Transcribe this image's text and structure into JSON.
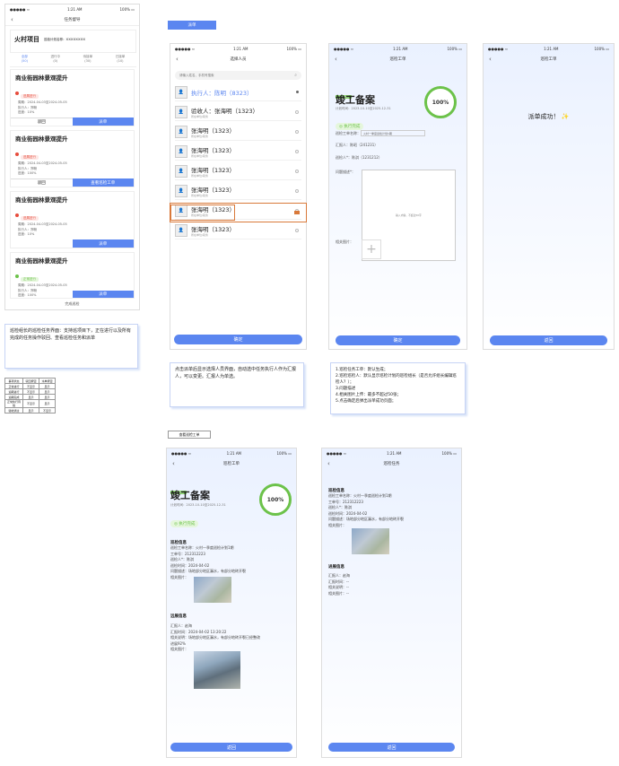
{
  "status_bar": {
    "left": "●●●●● ≈",
    "time": "1:21 AM",
    "battery": "100%"
  },
  "phone1": {
    "nav_title": "任务督导",
    "project_name": "火村项目",
    "project_sub": "巡检计划名称：XXXXXXXX",
    "tabs": [
      {
        "label": "全部",
        "count": "(50)"
      },
      {
        "label": "进行中",
        "count": "(0)"
      },
      {
        "label": "待接单",
        "count": "(30)"
      },
      {
        "label": "已接单",
        "count": "(10)"
      }
    ],
    "cards": [
      {
        "title": "商业街园林景观提升",
        "status": "进展进行",
        "status_color": "#e74c3c",
        "period": "周期：2024-04-03至2024-05-05",
        "executor": "执行人：郑畅",
        "progress": "进度：10%",
        "btn_left": "驳回",
        "btn_right": "派单"
      },
      {
        "title": "商业街园林景观提升",
        "status": "进展进行",
        "status_color": "#e74c3c",
        "period": "周期：2024-04-03至2024-05-05",
        "executor": "执行人：郑畅",
        "progress": "进度：100%",
        "btn_left": "驳回",
        "btn_right": "查看巡检工单"
      },
      {
        "title": "商业街园林景观提升",
        "status": "进展进行",
        "status_color": "#e74c3c",
        "period": "周期：2024-04-03至2024-05-05",
        "executor": "执行人：郑畅",
        "progress": "进度：10%",
        "btn_right": "派单"
      },
      {
        "title": "商业街园林景观提升",
        "status": "正常进行",
        "status_color": "#6cc24a",
        "period": "周期：2024-04-03至2024-05-05",
        "executor": "执行人：郑畅",
        "progress": "进度：100%",
        "btn_right": "派单"
      }
    ],
    "footer": "完成巡检"
  },
  "note1": "巡检组长的巡检任务界面：支持巡项目下，正在进行以及所有完成的任务操作驳回、查看巡检任务和派单",
  "status_table": {
    "headers": [
      "事项状态",
      "驳回按钮",
      "派单按钮"
    ],
    "rows": [
      [
        "正常进行",
        "不显示",
        "显示"
      ],
      [
        "逾期进行",
        "不显示",
        "显示"
      ],
      [
        "逾期完成",
        "显示",
        "显示"
      ],
      [
        "正常执行待验",
        "不显示",
        "显示"
      ],
      [
        "验收通过",
        "显示",
        "不显示"
      ]
    ]
  },
  "label_dispatch": "派单",
  "phone2": {
    "nav_title": "选择人员",
    "search_placeholder": "请输入姓名、手机号搜索",
    "people": [
      {
        "name": "执行人：陈明（8323）",
        "sub": "",
        "highlight": true
      },
      {
        "name": "验收人：张海明（1323）",
        "sub": "所在单位/职务"
      },
      {
        "name": "张海明（1323）",
        "sub": "所在单位/职务"
      },
      {
        "name": "张海明（1323）",
        "sub": "所在单位/职务"
      },
      {
        "name": "张海明（1323）",
        "sub": "所在单位/职务"
      },
      {
        "name": "张海明（1323）",
        "sub": "所在单位/职务",
        "selected": true
      },
      {
        "name": "张海明（1323）",
        "sub": "所在单位/职务"
      },
      {
        "name": "张海明（1323）",
        "sub": "所在单位/职务"
      }
    ],
    "confirm": "确定"
  },
  "note2": "点击派单后显示选择人员界面，自动选中任务执行人作为汇报人，可以变更。汇报人为单选。",
  "phone3": {
    "nav_title": "巡检工单",
    "tag": "工程项目",
    "title": "竣工备案",
    "plan": "计划时间：2023-10-10至2025-12-31",
    "status": "执行完成",
    "percent": "100%",
    "order_label": "巡检工单名称：",
    "order_value": "火村一季度巡检计划1期",
    "reporter": "汇报人：陈昭（241231）",
    "inspector": "巡检人*：陈淇（1231212）",
    "desc_label": "问题描述*：",
    "desc_placeholder": "输入内容，不超过50字",
    "photo_label": "相关图片：",
    "confirm": "确定"
  },
  "note3": [
    "1.巡检任务工单：默认生成；",
    "2.巡检巡检人：默认显示巡检计划的巡检组长（是否允许组长编辑巡检人？）；",
    "3.问题描述",
    "4.相关图片上传：最多不超过50张；",
    "5.点击确定后弹出派单成功页面；"
  ],
  "phone4": {
    "nav_title": "巡检工单",
    "message": "派单成功！",
    "back": "返回"
  },
  "label_view": "查看巡检工单",
  "phone5": {
    "nav_title": "巡检工单",
    "tag": "工程项目",
    "title": "竣工备案",
    "plan": "计划时间：2023-10-10至2025-12-31",
    "status": "执行完成",
    "percent": "100%",
    "sec1_title": "巡检信息",
    "sec1_lines": [
      "巡检工单名称：火村一季度巡检计划1期",
      "工单号：212312223",
      "巡检人*：陈淇",
      "巡检时间：2024-04-02",
      "问题描述：场地部分地区漏水，有部分地砖开裂",
      "相关图片："
    ],
    "sec2_title": "远展信息",
    "sec2_lines": [
      "汇报人：赵海",
      "汇报时间：2024-04-02 13:20:22",
      "相关说明：场地部分地区漏水，有部分地砖开裂已经整改",
      "进展92%",
      "相关图片："
    ],
    "back": "返回"
  },
  "phone6": {
    "nav_title": "巡检任务",
    "sec1_title": "巡检信息",
    "sec1_lines": [
      "巡检工单名称：火村一季度巡检计划1期",
      "工单号：212312223",
      "巡检人*：陈淇",
      "巡检时间：2024-04-02",
      "问题描述：场地部分地区漏水，有部分地砖开裂",
      "相关图片："
    ],
    "sec2_title": "进展信息",
    "sec2_lines": [
      "汇报人：赵海",
      "汇报时间：--",
      "相关说明：--",
      "相关图片：--"
    ],
    "back": "返回"
  }
}
